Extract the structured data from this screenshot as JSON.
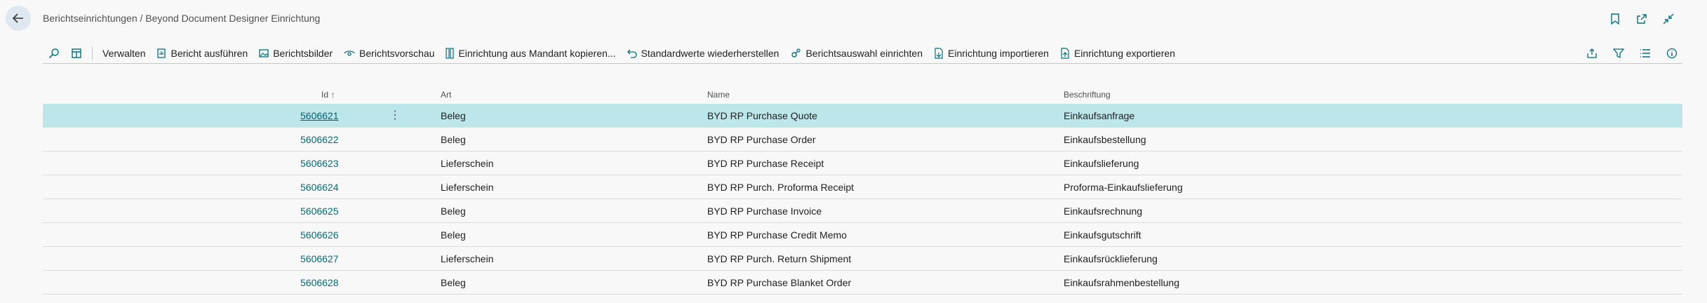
{
  "header": {
    "breadcrumb": "Berichtseinrichtungen / Beyond Document Designer Einrichtung"
  },
  "actions": [
    {
      "label": "Verwalten"
    },
    {
      "label": "Bericht ausführen",
      "icon": "report-icon"
    },
    {
      "label": "Berichtsbilder",
      "icon": "image-icon"
    },
    {
      "label": "Berichtsvorschau",
      "icon": "eye-icon"
    },
    {
      "label": "Einrichtung aus Mandant kopieren...",
      "icon": "copy-icon"
    },
    {
      "label": "Standardwerte wiederherstellen",
      "icon": "undo-icon"
    },
    {
      "label": "Berichtsauswahl einrichten",
      "icon": "settings-icon"
    },
    {
      "label": "Einrichtung importieren",
      "icon": "import-icon"
    },
    {
      "label": "Einrichtung exportieren",
      "icon": "export-icon"
    }
  ],
  "columns": {
    "id": "Id ↑",
    "art": "Art",
    "name": "Name",
    "beschriftung": "Beschriftung"
  },
  "rows": [
    {
      "id": "5606621",
      "art": "Beleg",
      "name": "BYD RP Purchase Quote",
      "beschriftung": "Einkaufsanfrage"
    },
    {
      "id": "5606622",
      "art": "Beleg",
      "name": "BYD RP Purchase Order",
      "beschriftung": "Einkaufsbestellung"
    },
    {
      "id": "5606623",
      "art": "Lieferschein",
      "name": "BYD RP Purchase Receipt",
      "beschriftung": "Einkaufslieferung"
    },
    {
      "id": "5606624",
      "art": "Lieferschein",
      "name": "BYD RP Purch. Proforma Receipt",
      "beschriftung": "Proforma-Einkaufslieferung"
    },
    {
      "id": "5606625",
      "art": "Beleg",
      "name": "BYD RP Purchase Invoice",
      "beschriftung": "Einkaufsrechnung"
    },
    {
      "id": "5606626",
      "art": "Beleg",
      "name": "BYD RP Purchase Credit Memo",
      "beschriftung": "Einkaufsgutschrift"
    },
    {
      "id": "5606627",
      "art": "Lieferschein",
      "name": "BYD RP Purch. Return Shipment",
      "beschriftung": "Einkaufsrücklieferung"
    },
    {
      "id": "5606628",
      "art": "Beleg",
      "name": "BYD RP Purchase Blanket Order",
      "beschriftung": "Einkaufsrahmenbestellung"
    }
  ],
  "colors": {
    "accent": "#00707f",
    "selected_row": "#bde6ea",
    "back_button": "#dfe7ef"
  },
  "icons": {
    "bookmark": "bookmark-icon",
    "open_new": "open-new-window-icon",
    "collapse": "collapse-icon",
    "search": "search-icon",
    "layout": "layout-icon",
    "share": "share-icon",
    "filter": "filter-icon",
    "list": "list-view-icon",
    "info": "info-icon"
  }
}
